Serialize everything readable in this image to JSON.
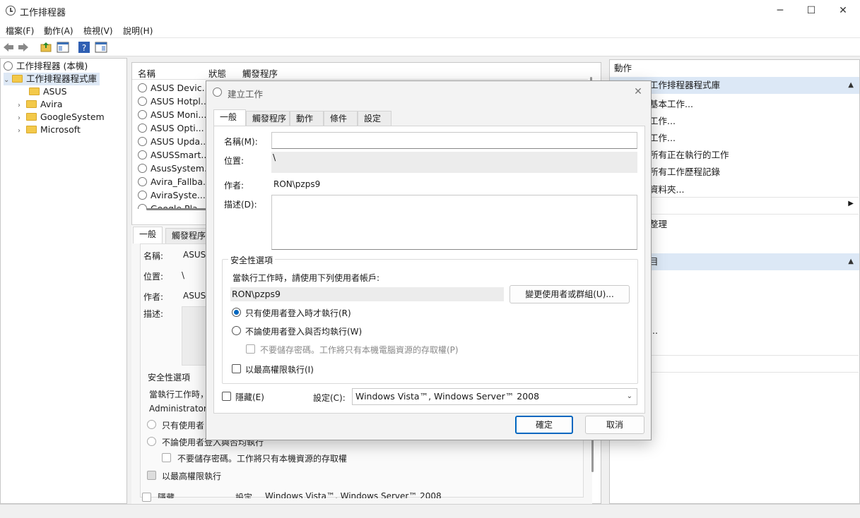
{
  "window": {
    "title": "工作排程器"
  },
  "menubar": {
    "items": [
      "檔案(F)",
      "動作(A)",
      "檢視(V)",
      "說明(H)"
    ]
  },
  "tree": {
    "root": "工作排程器 (本機)",
    "library": "工作排程器程式庫",
    "children": [
      "ASUS",
      "Avira",
      "GoogleSystem",
      "Microsoft"
    ]
  },
  "tasklist": {
    "columns": [
      "名稱",
      "狀態",
      "觸發程序"
    ],
    "rows": [
      "ASUS Devic...",
      "ASUS Hotpl...",
      "ASUS Moni...",
      "ASUS Opti...",
      "ASUS Upda...",
      "ASUSSmart...",
      "AsusSystem...",
      "Avira_Fallba...",
      "AviraSyste...",
      "Google Pla..."
    ]
  },
  "background_details": {
    "tabs": [
      "一般",
      "觸發程序"
    ],
    "name_label": "名稱:",
    "name_value": "ASUS",
    "location_label": "位置:",
    "location_value": "\\",
    "author_label": "作者:",
    "author_value": "ASUS",
    "desc_label": "描述:",
    "security_title": "安全性選項",
    "run_as_label": "當執行工作時，",
    "account": "Administrators",
    "radio1": "只有使用者",
    "radio2": "不論使用者登入與否均執行",
    "nopwd": "不要儲存密碼。工作將只有本機資源的存取權",
    "highest": "以最高權限執行",
    "hidden": "隱藏",
    "config_label": "設定",
    "config_value": "Windows Vista™, Windows Server™ 2008"
  },
  "actions": {
    "header": "動作",
    "section1": "工作排程器程式庫",
    "items": [
      "基本工作...",
      "工作...",
      "工作...",
      "所有正在執行的工作",
      "所有工作歷程記錄",
      "資料夾...",
      "",
      "整理"
    ],
    "section2": "目"
  },
  "dialog": {
    "title": "建立工作",
    "tabs": [
      "一般",
      "觸發程序",
      "動作",
      "條件",
      "設定"
    ],
    "name_label": "名稱(M):",
    "name_value": "",
    "location_label": "位置:",
    "location_value": "\\",
    "author_label": "作者:",
    "author_value": "RON\\pzps9",
    "desc_label": "描述(D):",
    "desc_value": "",
    "security": {
      "title": "安全性選項",
      "run_as_label": "當執行工作時，請使用下列使用者帳戶:",
      "account": "RON\\pzps9",
      "change_button": "變更使用者或群組(U)...",
      "radio_logged_on": "只有使用者登入時才執行(R)",
      "radio_whether": "不論使用者登入與否均執行(W)",
      "no_store_password": "不要儲存密碼。工作將只有本機電腦資源的存取權(P)",
      "highest_privileges": "以最高權限執行(I)"
    },
    "hidden_label": "隱藏(E)",
    "config_label": "設定(C):",
    "config_value": "Windows Vista™, Windows Server™ 2008",
    "ok": "確定",
    "cancel": "取消"
  }
}
